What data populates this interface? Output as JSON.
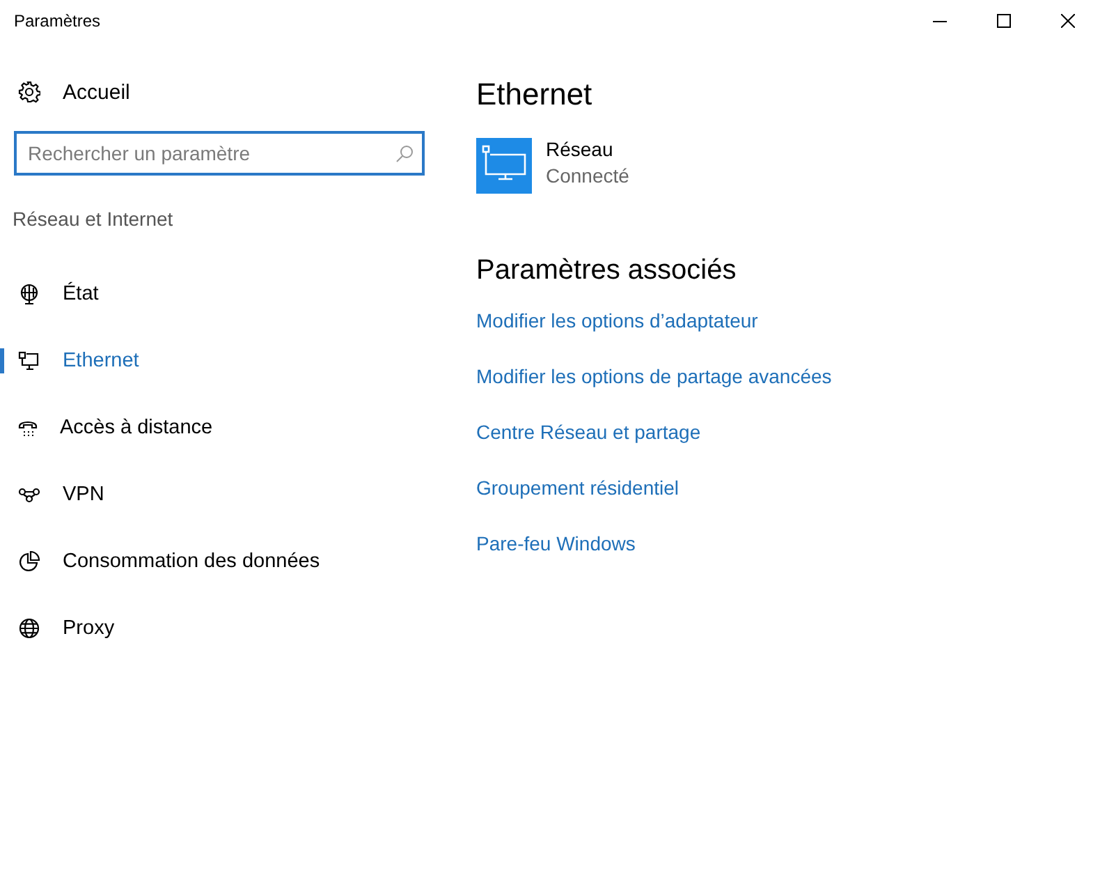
{
  "window": {
    "title": "Paramètres"
  },
  "home": {
    "label": "Accueil"
  },
  "search": {
    "placeholder": "Rechercher un paramètre"
  },
  "section": "Réseau et Internet",
  "nav": [
    {
      "label": "État",
      "selected": false
    },
    {
      "label": "Ethernet",
      "selected": true
    },
    {
      "label": "Accès à distance",
      "selected": false
    },
    {
      "label": "VPN",
      "selected": false
    },
    {
      "label": "Consommation des données",
      "selected": false
    },
    {
      "label": "Proxy",
      "selected": false
    }
  ],
  "main": {
    "title": "Ethernet",
    "network": {
      "name": "Réseau",
      "status": "Connecté"
    },
    "related_title": "Paramètres associés",
    "links": [
      "Modifier les options d’adaptateur",
      "Modifier les options de partage avancées",
      "Centre Réseau et partage",
      "Groupement résidentiel",
      "Pare-feu Windows"
    ]
  }
}
